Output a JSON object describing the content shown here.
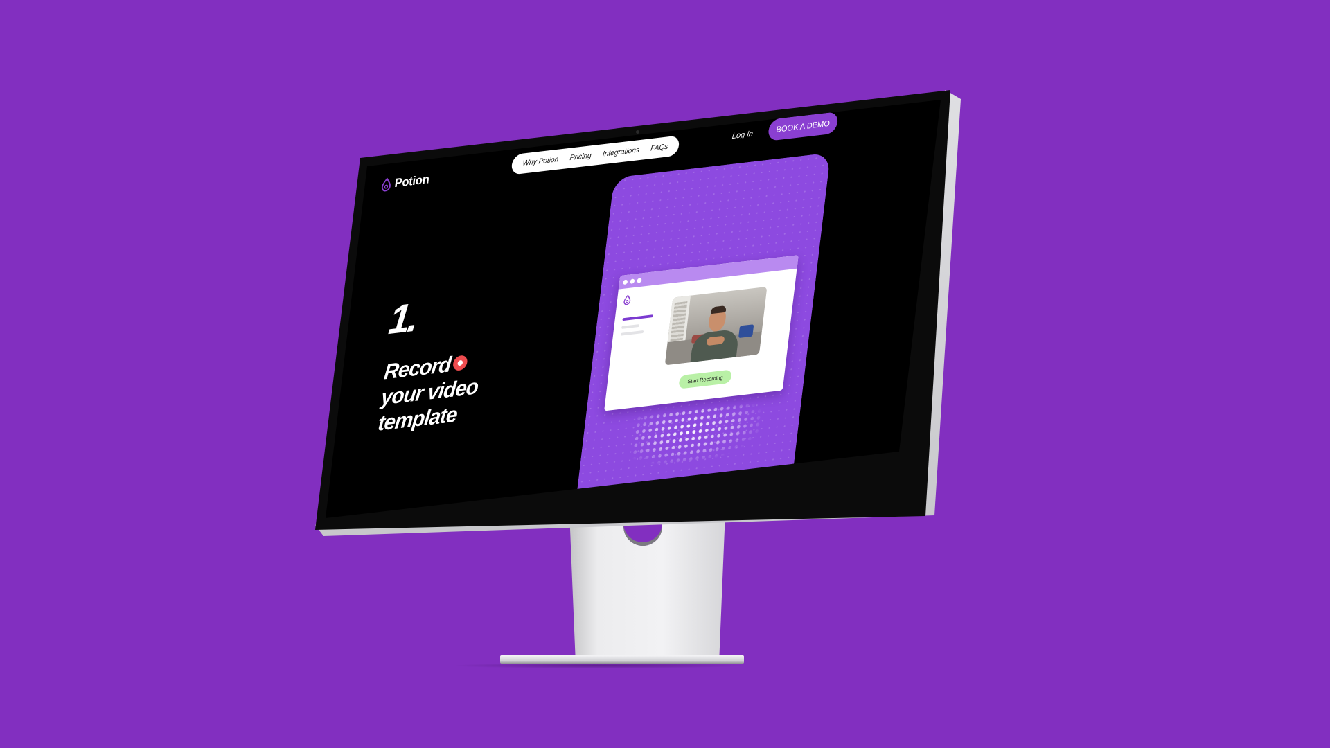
{
  "colors": {
    "background": "#822fc0",
    "brand_purple": "#8a3fd1",
    "record_red": "#ee4c4f",
    "start_green": "#b9f0a6"
  },
  "site": {
    "logo_text": "Potion",
    "logo_icon": "potion-drop-icon"
  },
  "nav": {
    "items": [
      {
        "label": "Why Potion"
      },
      {
        "label": "Pricing"
      },
      {
        "label": "Integrations"
      },
      {
        "label": "FAQs"
      }
    ],
    "login_label": "Log in",
    "demo_label": "BOOK A DEMO"
  },
  "hero": {
    "step_number": "1.",
    "line1": "Record",
    "line2": "your video",
    "line3": "template",
    "record_icon": "record-icon"
  },
  "mock_app": {
    "start_button": "Start Recording"
  }
}
